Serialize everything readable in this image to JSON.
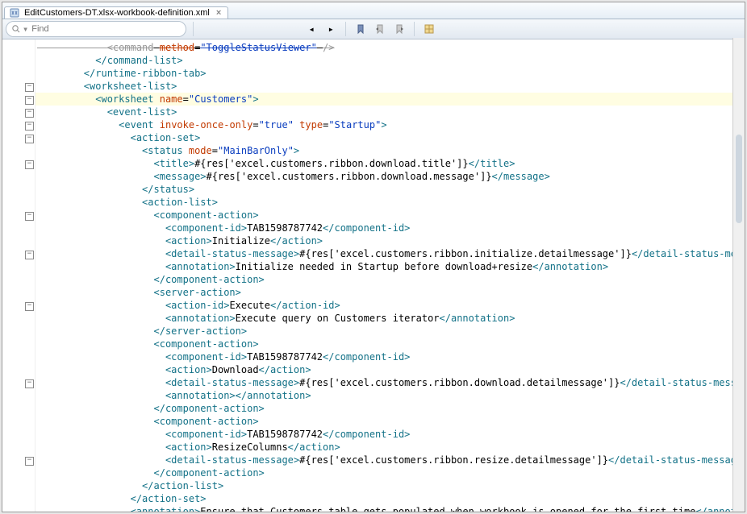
{
  "tab": {
    "title": "EditCustomers-DT.xlsx-workbook-definition.xml"
  },
  "find": {
    "placeholder": "Find"
  },
  "folds": [
    54,
    70,
    86,
    102,
    118,
    150,
    214,
    262,
    326,
    422,
    518
  ],
  "lines": [
    {
      "indent": 6,
      "hl": false,
      "segs": [
        [
          "a",
          "<command"
        ],
        [
          "x",
          " "
        ],
        [
          "t",
          "method"
        ],
        [
          "x",
          "="
        ],
        [
          "v",
          "\"ToggleStatusViewer\""
        ],
        [
          "x",
          " "
        ],
        [
          "a",
          "/>"
        ]
      ],
      "strike": true
    },
    {
      "indent": 5,
      "hl": false,
      "segs": [
        [
          "a",
          "</command-list>"
        ]
      ]
    },
    {
      "indent": 4,
      "hl": false,
      "segs": [
        [
          "a",
          "</runtime-ribbon-tab>"
        ]
      ]
    },
    {
      "indent": 4,
      "hl": false,
      "segs": [
        [
          "a",
          "<worksheet-list>"
        ]
      ]
    },
    {
      "indent": 5,
      "hl": true,
      "segs": [
        [
          "a",
          "<worksheet"
        ],
        [
          "x",
          " "
        ],
        [
          "t",
          "name"
        ],
        [
          "x",
          "="
        ],
        [
          "v",
          "\"Customers\""
        ],
        [
          "a",
          ">"
        ]
      ]
    },
    {
      "indent": 6,
      "hl": false,
      "segs": [
        [
          "a",
          "<event-list>"
        ]
      ]
    },
    {
      "indent": 7,
      "hl": false,
      "segs": [
        [
          "a",
          "<event"
        ],
        [
          "x",
          " "
        ],
        [
          "t",
          "invoke-once-only"
        ],
        [
          "x",
          "="
        ],
        [
          "v",
          "\"true\""
        ],
        [
          "x",
          " "
        ],
        [
          "t",
          "type"
        ],
        [
          "x",
          "="
        ],
        [
          "v",
          "\"Startup\""
        ],
        [
          "a",
          ">"
        ]
      ]
    },
    {
      "indent": 8,
      "hl": false,
      "segs": [
        [
          "a",
          "<action-set>"
        ]
      ]
    },
    {
      "indent": 9,
      "hl": false,
      "segs": [
        [
          "a",
          "<status"
        ],
        [
          "x",
          " "
        ],
        [
          "t",
          "mode"
        ],
        [
          "x",
          "="
        ],
        [
          "v",
          "\"MainBarOnly\""
        ],
        [
          "a",
          ">"
        ]
      ]
    },
    {
      "indent": 10,
      "hl": false,
      "segs": [
        [
          "a",
          "<title>"
        ],
        [
          "x",
          "#{res['excel.customers.ribbon.download.title']}"
        ],
        [
          "a",
          "</title>"
        ]
      ]
    },
    {
      "indent": 10,
      "hl": false,
      "segs": [
        [
          "a",
          "<message>"
        ],
        [
          "x",
          "#{res['excel.customers.ribbon.download.message']}"
        ],
        [
          "a",
          "</message>"
        ]
      ]
    },
    {
      "indent": 9,
      "hl": false,
      "segs": [
        [
          "a",
          "</status>"
        ]
      ]
    },
    {
      "indent": 9,
      "hl": false,
      "segs": [
        [
          "a",
          "<action-list>"
        ]
      ]
    },
    {
      "indent": 10,
      "hl": false,
      "segs": [
        [
          "a",
          "<component-action>"
        ]
      ]
    },
    {
      "indent": 11,
      "hl": false,
      "segs": [
        [
          "a",
          "<component-id>"
        ],
        [
          "x",
          "TAB1598787742"
        ],
        [
          "a",
          "</component-id>"
        ]
      ]
    },
    {
      "indent": 11,
      "hl": false,
      "segs": [
        [
          "a",
          "<action>"
        ],
        [
          "x",
          "Initialize"
        ],
        [
          "a",
          "</action>"
        ]
      ]
    },
    {
      "indent": 11,
      "hl": false,
      "segs": [
        [
          "a",
          "<detail-status-message>"
        ],
        [
          "x",
          "#{res['excel.customers.ribbon.initialize.detailmessage']}"
        ],
        [
          "a",
          "</detail-status-message>"
        ]
      ]
    },
    {
      "indent": 11,
      "hl": false,
      "segs": [
        [
          "a",
          "<annotation>"
        ],
        [
          "x",
          "Initialize needed in Startup before download+resize"
        ],
        [
          "a",
          "</annotation>"
        ]
      ]
    },
    {
      "indent": 10,
      "hl": false,
      "segs": [
        [
          "a",
          "</component-action>"
        ]
      ]
    },
    {
      "indent": 10,
      "hl": false,
      "segs": [
        [
          "a",
          "<server-action>"
        ]
      ]
    },
    {
      "indent": 11,
      "hl": false,
      "segs": [
        [
          "a",
          "<action-id>"
        ],
        [
          "x",
          "Execute"
        ],
        [
          "a",
          "</action-id>"
        ]
      ]
    },
    {
      "indent": 11,
      "hl": false,
      "segs": [
        [
          "a",
          "<annotation>"
        ],
        [
          "x",
          "Execute query on Customers iterator"
        ],
        [
          "a",
          "</annotation>"
        ]
      ]
    },
    {
      "indent": 10,
      "hl": false,
      "segs": [
        [
          "a",
          "</server-action>"
        ]
      ]
    },
    {
      "indent": 10,
      "hl": false,
      "segs": [
        [
          "a",
          "<component-action>"
        ]
      ]
    },
    {
      "indent": 11,
      "hl": false,
      "segs": [
        [
          "a",
          "<component-id>"
        ],
        [
          "x",
          "TAB1598787742"
        ],
        [
          "a",
          "</component-id>"
        ]
      ]
    },
    {
      "indent": 11,
      "hl": false,
      "segs": [
        [
          "a",
          "<action>"
        ],
        [
          "x",
          "Download"
        ],
        [
          "a",
          "</action>"
        ]
      ]
    },
    {
      "indent": 11,
      "hl": false,
      "segs": [
        [
          "a",
          "<detail-status-message>"
        ],
        [
          "x",
          "#{res['excel.customers.ribbon.download.detailmessage']}"
        ],
        [
          "a",
          "</detail-status-message>"
        ]
      ]
    },
    {
      "indent": 11,
      "hl": false,
      "segs": [
        [
          "a",
          "<annotation></annotation>"
        ]
      ]
    },
    {
      "indent": 10,
      "hl": false,
      "segs": [
        [
          "a",
          "</component-action>"
        ]
      ]
    },
    {
      "indent": 10,
      "hl": false,
      "segs": [
        [
          "a",
          "<component-action>"
        ]
      ]
    },
    {
      "indent": 11,
      "hl": false,
      "segs": [
        [
          "a",
          "<component-id>"
        ],
        [
          "x",
          "TAB1598787742"
        ],
        [
          "a",
          "</component-id>"
        ]
      ]
    },
    {
      "indent": 11,
      "hl": false,
      "segs": [
        [
          "a",
          "<action>"
        ],
        [
          "x",
          "ResizeColumns"
        ],
        [
          "a",
          "</action>"
        ]
      ]
    },
    {
      "indent": 11,
      "hl": false,
      "segs": [
        [
          "a",
          "<detail-status-message>"
        ],
        [
          "x",
          "#{res['excel.customers.ribbon.resize.detailmessage']}"
        ],
        [
          "a",
          "</detail-status-message>"
        ]
      ]
    },
    {
      "indent": 10,
      "hl": false,
      "segs": [
        [
          "a",
          "</component-action>"
        ]
      ]
    },
    {
      "indent": 9,
      "hl": false,
      "segs": [
        [
          "a",
          "</action-list>"
        ]
      ]
    },
    {
      "indent": 8,
      "hl": false,
      "segs": [
        [
          "a",
          "</action-set>"
        ]
      ]
    },
    {
      "indent": 8,
      "hl": false,
      "segs": [
        [
          "a",
          "<annotation>"
        ],
        [
          "x",
          "Ensure that Customers table gets populated when workbook is opened for the first time"
        ],
        [
          "a",
          "</annotation>"
        ]
      ]
    }
  ],
  "icons": {
    "nav_prev": "◄",
    "nav_next": "►",
    "bookmark": "🔖",
    "flag_l": "⚑",
    "flag_r": "⚑",
    "grid": "▦"
  }
}
